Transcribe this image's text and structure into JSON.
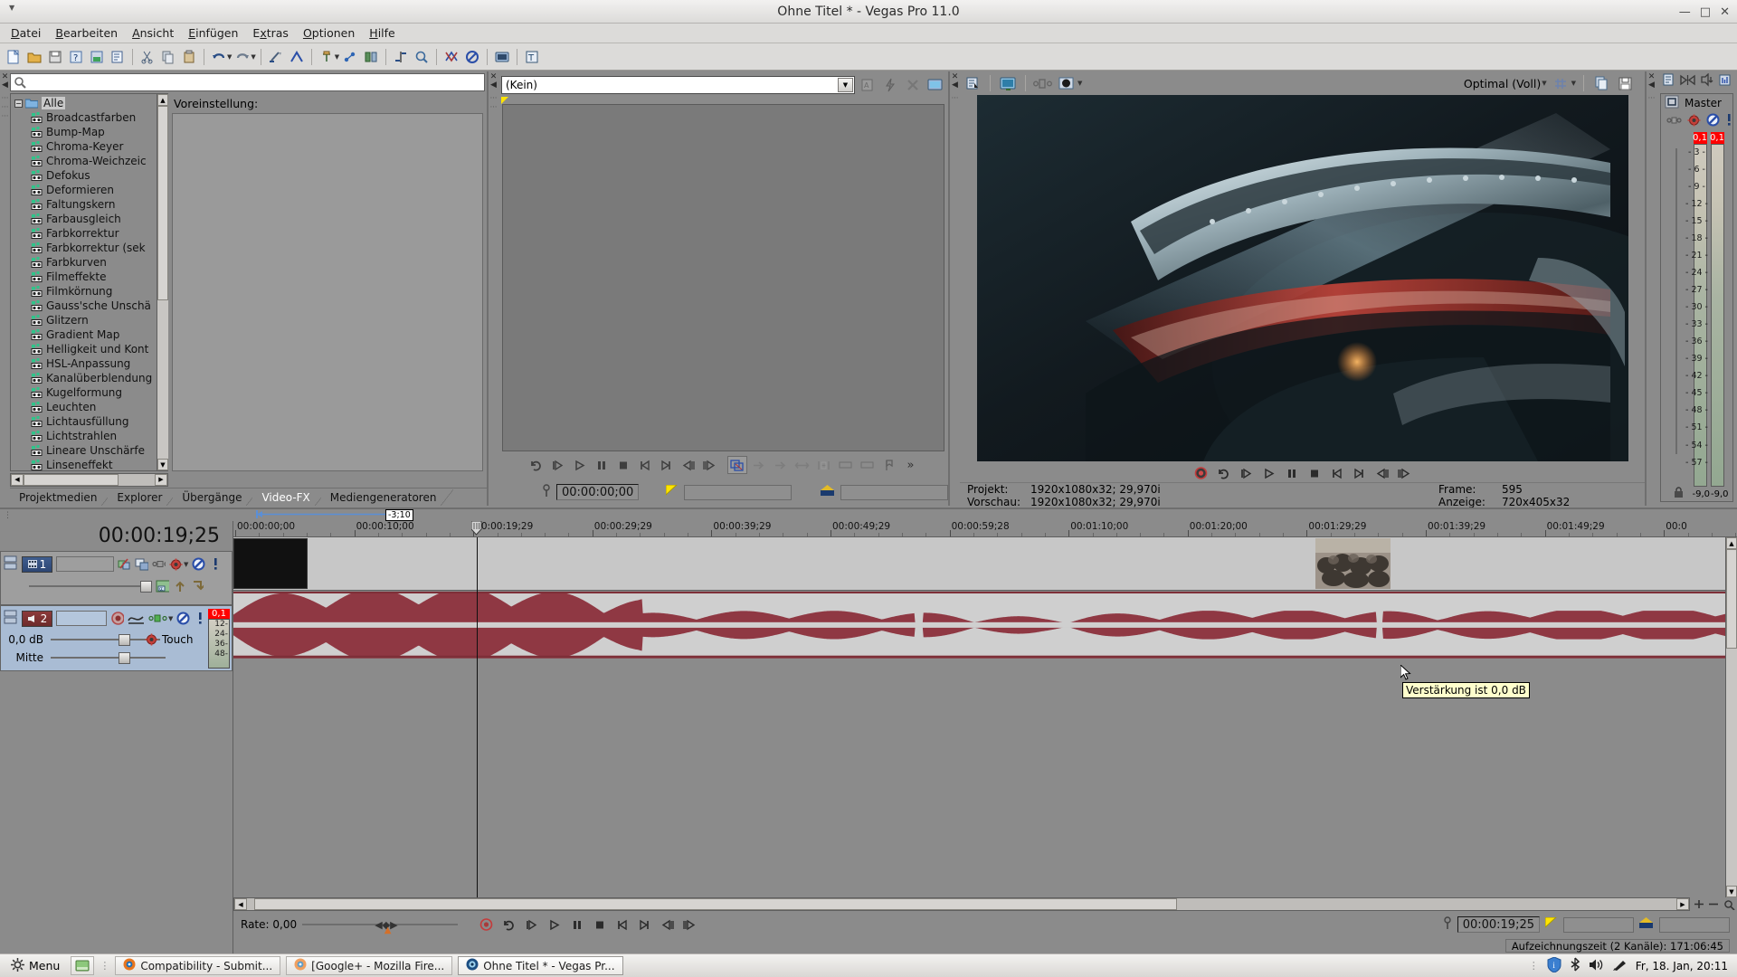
{
  "window": {
    "title": "Ohne Titel * - Vegas Pro 11.0",
    "buttons": [
      "—",
      "□",
      "✕"
    ],
    "collapse_icon": "caret-down-icon"
  },
  "menu": {
    "items": [
      {
        "label": "Datei",
        "accel": "D"
      },
      {
        "label": "Bearbeiten",
        "accel": "B"
      },
      {
        "label": "Ansicht",
        "accel": "A"
      },
      {
        "label": "Einfügen",
        "accel": "E"
      },
      {
        "label": "Extras",
        "accel": "x"
      },
      {
        "label": "Optionen",
        "accel": "O"
      },
      {
        "label": "Hilfe",
        "accel": "H"
      }
    ]
  },
  "toolbar": {
    "buttons": [
      "new-project-icon",
      "open-project-icon",
      "save-project-icon",
      "project-properties-icon",
      "render-as-icon",
      "properties-icon",
      "sep",
      "cut-icon",
      "copy-icon",
      "paste-icon",
      "sep",
      "undo-icon",
      "undo-dropdown-icon",
      "redo-icon",
      "redo-dropdown-icon",
      "sep",
      "enable-snapping-icon",
      "auto-ripple-icon",
      "sep",
      "normal-edit-tool-icon",
      "edit-tool-dropdown-icon",
      "envelope-edit-tool-icon",
      "selection-edit-tool-icon",
      "sep",
      "zoom-edit-tool-icon",
      "zoom-tool-icon",
      "sep",
      "crossfade-icon",
      "mute-icon",
      "sep",
      "open-video-preview-icon",
      "sep",
      "insert-text-media-icon"
    ]
  },
  "fx_panel": {
    "search_placeholder": "",
    "search_icon": "magnifier-icon",
    "tree_root": "Alle",
    "items": [
      "Broadcastfarben",
      "Bump-Map",
      "Chroma-Keyer",
      "Chroma-Weichzeic",
      "Defokus",
      "Deformieren",
      "Faltungskern",
      "Farbausgleich",
      "Farbkorrektur",
      "Farbkorrektur (sek",
      "Farbkurven",
      "Filmeffekte",
      "Filmkörnung",
      "Gauss'sche Unschä",
      "Glitzern",
      "Gradient Map",
      "Helligkeit und Kont",
      "HSL-Anpassung",
      "Kanalüberblendung",
      "Kugelformung",
      "Leuchten",
      "Lichtausfüllung",
      "Lichtstrahlen",
      "Lineare Unschärfe",
      "Linseneffekt"
    ],
    "preset_label": "Voreinstellung:",
    "tabs": [
      {
        "label": "Projektmedien",
        "active": false
      },
      {
        "label": "Explorer",
        "active": false
      },
      {
        "label": "Übergänge",
        "active": false
      },
      {
        "label": "Video-FX",
        "active": true
      },
      {
        "label": "Mediengeneratoren",
        "active": false
      }
    ]
  },
  "trimmer": {
    "combo_value": "(Kein)",
    "combo_icon": "chevron-down-icon",
    "side_buttons": [
      "media-properties-icon",
      "streaming-icon",
      "remove-icon",
      "video-preview-icon"
    ],
    "transport": [
      "loop-playback-icon",
      "play-from-start-icon",
      "play-icon",
      "pause-icon",
      "stop-icon",
      "go-to-start-icon",
      "go-to-end-icon",
      "previous-frame-icon",
      "next-frame-icon"
    ],
    "edit_buttons": [
      "create-subclip-icon",
      "add-media-to-timeline-icon",
      "add-media-cursor-icon",
      "fit-to-fill-icon",
      "select-loop-region-icon",
      "mark-in-icon",
      "mark-out-icon",
      "marker-icon",
      "more-icon"
    ],
    "timecode": "00:00:00;00",
    "timecode_icon": "position-marker-icon",
    "in_icon": "mark-in-icon",
    "out_icon": "mark-out-icon",
    "in_value": "",
    "out_value": ""
  },
  "preview": {
    "top_buttons": [
      "project-video-properties-icon",
      "preview-on-external-monitor-icon"
    ],
    "split_icon": "split-screen-view-icon",
    "overlay_icon": "overlay-icon",
    "quality": "Optimal (Voll)",
    "quality_caret": "chevron-down-icon",
    "grid_icon": "grid-overlay-icon",
    "grid_caret": "chevron-down-icon",
    "copy_icon": "copy-snapshot-to-clipboard-icon",
    "save_icon": "save-snapshot-to-file-icon",
    "transport": [
      "record-icon",
      "loop-icon",
      "play-from-start-icon",
      "play-icon",
      "pause-icon",
      "stop-icon",
      "go-to-start-icon",
      "go-to-end-icon",
      "previous-frame-icon",
      "next-frame-icon"
    ],
    "info": {
      "project_label": "Projekt:",
      "project_value": "1920x1080x32; 29,970i",
      "preview_label": "Vorschau:",
      "preview_value": "1920x1080x32; 29,970i",
      "frame_label": "Frame:",
      "frame_value": "595",
      "display_label": "Anzeige:",
      "display_value": "720x405x32"
    }
  },
  "master": {
    "top_buttons": [
      "mixing-console-icon",
      "master-bus-icon",
      "audio-out-icon",
      "meter-icon"
    ],
    "title": "Master",
    "title_icon": "master-bus-box-icon",
    "icons": [
      "channel-routing-icon",
      "fx-icon",
      "mute-icon",
      "solo-icon"
    ],
    "clip_left": "0,1",
    "clip_right": "0,1",
    "scale": [
      "3",
      "6",
      "9",
      "12",
      "15",
      "18",
      "21",
      "24",
      "27",
      "30",
      "33",
      "36",
      "39",
      "42",
      "45",
      "48",
      "51",
      "54",
      "57"
    ],
    "lock_icon": "lock-icon",
    "value_left": "-9,0",
    "value_right": "-9,0"
  },
  "timeline": {
    "selection_label": "-3;10",
    "cursor_timecode": "00:00:19;25",
    "ruler_labels": [
      "00:00:00;00",
      "00:00:10;00",
      "00:00:19;29",
      "00:00:29;29",
      "00:00:39;29",
      "00:00:49;29",
      "00:00:59;28",
      "00:01:10;00",
      "00:01:20;00",
      "00:01:29;29",
      "00:01:39;29",
      "00:01:49;29",
      "00:0"
    ],
    "tracks": [
      {
        "number": "1",
        "type": "video",
        "name": "",
        "icons": [
          "track-fx-icon",
          "compositing-mode-icon",
          "track-motion-icon",
          "automation-settings-icon",
          "mute-icon",
          "solo-icon"
        ],
        "level_icons": [
          "parent-compositing-icon",
          "make-compositing-child-icon",
          "make-compositing-parent-icon"
        ]
      },
      {
        "number": "2",
        "type": "audio",
        "name": "",
        "gain": "0,0 dB",
        "pan": "Mitte",
        "automation_mode": "Touch",
        "automation_caret": "chevron-down-icon",
        "icons": [
          "arm-for-record-icon",
          "track-fx-icon",
          "channel-routing-icon",
          "mute-icon",
          "solo-icon"
        ],
        "meter_clip": "0,1",
        "meter_scale": [
          "12",
          "24",
          "36",
          "48"
        ]
      }
    ],
    "tooltip": "Verstärkung ist 0,0 dB",
    "rate_label": "Rate: 0,00",
    "transport": [
      "record-icon",
      "loop-icon",
      "play-from-start-icon",
      "play-icon",
      "pause-icon",
      "stop-icon",
      "go-to-start-icon",
      "go-to-end-icon",
      "previous-frame-icon",
      "next-frame-icon"
    ],
    "cursor_field": "00:00:19;25",
    "cursor_field_icon": "position-marker-icon",
    "in_value": "",
    "out_value": "",
    "status": "Aufzeichnungszeit (2 Kanäle): 171:06:45"
  },
  "taskbar": {
    "menu_label": "Menu",
    "menu_icon": "gear-icon",
    "show_desktop_icon": "show-desktop-icon",
    "items": [
      {
        "label": "Compatibility - Submit...",
        "icon": "firefox-icon",
        "active": false
      },
      {
        "label": "[Google+ - Mozilla Fire...",
        "icon": "firefox-icon",
        "active": false
      },
      {
        "label": "Ohne Titel * - Vegas Pr...",
        "icon": "vegas-icon",
        "active": true
      }
    ],
    "tray": [
      "info-icon",
      "bluetooth-icon",
      "volume-icon",
      "brightness-icon"
    ],
    "clock": "Fr, 18. Jan, 20:11"
  },
  "colors": {
    "window_chrome": "#dcdbd9",
    "app_bg": "#8b8b8b",
    "audio_track_bg": "#a9bcd4",
    "waveform": "#8f3843",
    "clip_red": "#ff0000",
    "tooltip_bg": "#ffffcc"
  }
}
